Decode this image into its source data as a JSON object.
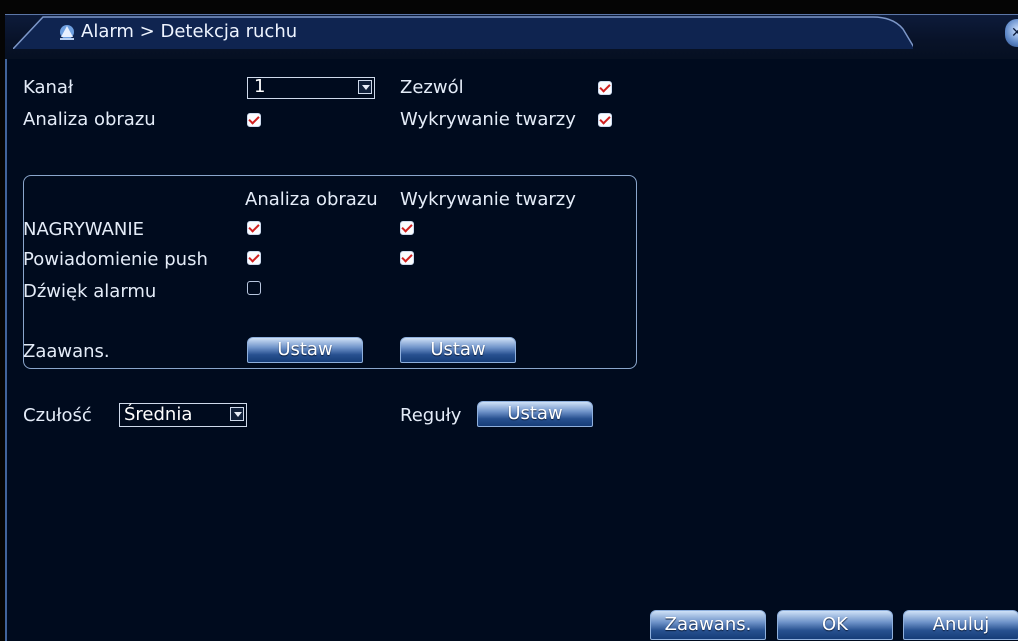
{
  "title": {
    "text": "Alarm > Detekcja ruchu"
  },
  "top": {
    "channel_label": "Kanał",
    "channel_value": "1",
    "enable_label": "Zezwól",
    "enable_checked": true,
    "image_analysis_label": "Analiza obrazu",
    "image_analysis_checked": true,
    "face_detection_label": "Wykrywanie twarzy",
    "face_detection_checked": true
  },
  "group": {
    "col1_header": "Analiza obrazu",
    "col2_header": "Wykrywanie twarzy",
    "rows": [
      {
        "label": "NAGRYWANIE",
        "col1": true,
        "col2": true
      },
      {
        "label": "Powiadomienie push",
        "col1": true,
        "col2": true
      },
      {
        "label": "Dźwięk alarmu",
        "col1": false,
        "col2": null
      }
    ],
    "advanced_label": "Zaawans.",
    "set_button_1": "Ustaw",
    "set_button_2": "Ustaw"
  },
  "bottom": {
    "sensitivity_label": "Czułość",
    "sensitivity_value": "Średnia",
    "rules_label": "Reguły",
    "rules_button": "Ustaw"
  },
  "footer": {
    "advanced_button": "Zaawans.",
    "ok_button": "OK",
    "cancel_button": "Anuluj"
  },
  "colors": {
    "background": "#000b1e",
    "check_mark": "#d02020",
    "button_top": "#cfe1f7",
    "button_bottom": "#163d78"
  }
}
